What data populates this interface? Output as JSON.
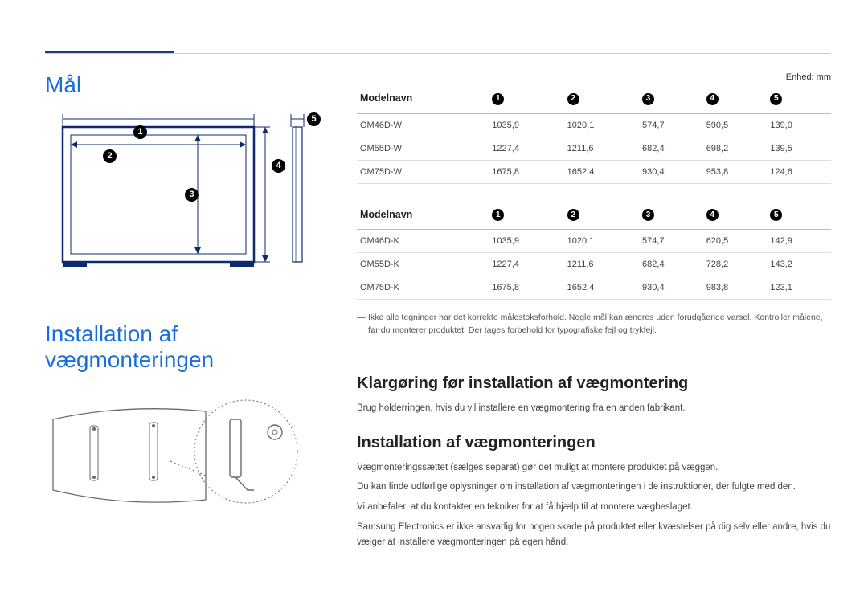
{
  "headings": {
    "dimensions": "Mål",
    "wallmount": "Installation af vægmonteringen",
    "prep": "Klargøring før installation af vægmontering",
    "install": "Installation af vægmonteringen"
  },
  "unit_label": "Enhed: mm",
  "table_header_label": "Modelnavn",
  "columns": [
    "1",
    "2",
    "3",
    "4",
    "5"
  ],
  "table1": [
    {
      "model": "OM46D-W",
      "c1": "1035,9",
      "c2": "1020,1",
      "c3": "574,7",
      "c4": "590,5",
      "c5": "139,0"
    },
    {
      "model": "OM55D-W",
      "c1": "1227,4",
      "c2": "1211,6",
      "c3": "682,4",
      "c4": "698,2",
      "c5": "139,5"
    },
    {
      "model": "OM75D-W",
      "c1": "1675,8",
      "c2": "1652,4",
      "c3": "930,4",
      "c4": "953,8",
      "c5": "124,6"
    }
  ],
  "table2": [
    {
      "model": "OM46D-K",
      "c1": "1035,9",
      "c2": "1020,1",
      "c3": "574,7",
      "c4": "620,5",
      "c5": "142,9"
    },
    {
      "model": "OM55D-K",
      "c1": "1227,4",
      "c2": "1211,6",
      "c3": "682,4",
      "c4": "728,2",
      "c5": "143,2"
    },
    {
      "model": "OM75D-K",
      "c1": "1675,8",
      "c2": "1652,4",
      "c3": "930,4",
      "c4": "983,8",
      "c5": "123,1"
    }
  ],
  "footnote": "Ikke alle tegninger har det korrekte målestoksforhold. Nogle mål kan ændres uden forudgående varsel. Kontroller målene, før du monterer produktet. Der tages forbehold for typografiske fejl og trykfejl.",
  "para_prep": "Brug holderringen, hvis du vil installere en vægmontering fra en anden fabrikant.",
  "para_install": [
    "Vægmonteringssættet (sælges separat) gør det muligt at montere produktet på væggen.",
    "Du kan finde udførlige oplysninger om installation af vægmonteringen i de instruktioner, der fulgte med den.",
    "Vi anbefaler, at du kontakter en tekniker for at få hjælp til at montere vægbeslaget.",
    "Samsung Electronics er ikke ansvarlig for nogen skade på produktet eller kvæstelser på dig selv eller andre, hvis du vælger at installere vægmonteringen på egen hånd."
  ],
  "diagram_labels": {
    "1": "1",
    "2": "2",
    "3": "3",
    "4": "4",
    "5": "5"
  }
}
